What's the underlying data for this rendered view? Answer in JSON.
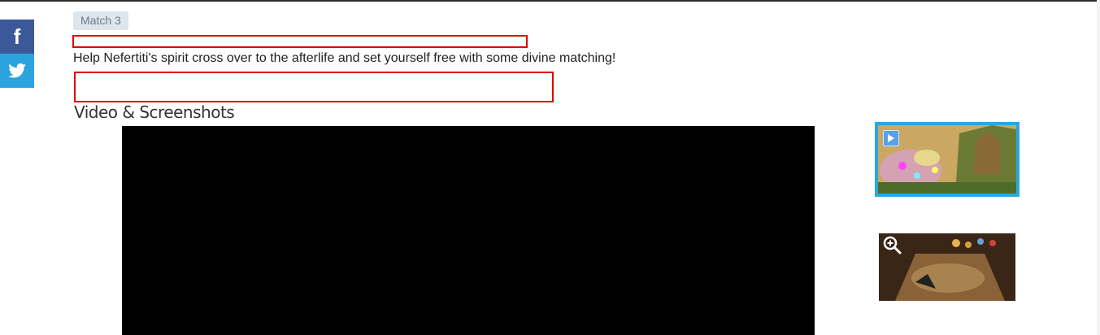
{
  "social": {
    "facebook_icon": "facebook-icon",
    "twitter_icon": "twitter-icon"
  },
  "tag": {
    "label": "Match 3"
  },
  "description": "Help Nefertiti's spirit cross over to the afterlife and set yourself free with some divine matching!",
  "section": {
    "title": "Video & Screenshots"
  },
  "colors": {
    "facebook": "#3b5998",
    "twitter": "#2aa3df",
    "tag_bg": "#dde6ec",
    "highlight_border": "#e00000",
    "thumb_selected_border": "#29a8e0"
  },
  "media": {
    "thumbnails": [
      {
        "type": "video",
        "icon": "play-icon",
        "selected": true
      },
      {
        "type": "screenshot",
        "icon": "zoom-in-icon",
        "selected": false
      }
    ]
  }
}
